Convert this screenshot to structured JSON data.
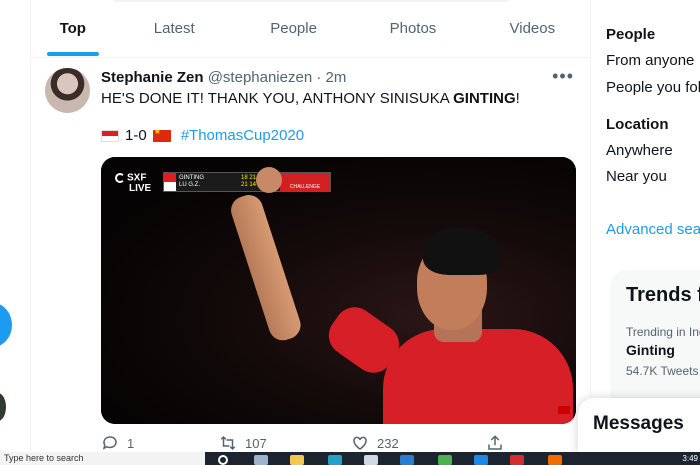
{
  "tabs": [
    {
      "label": "Top",
      "active": true
    },
    {
      "label": "Latest",
      "active": false
    },
    {
      "label": "People",
      "active": false
    },
    {
      "label": "Photos",
      "active": false
    },
    {
      "label": "Videos",
      "active": false
    }
  ],
  "tweet": {
    "author": "Stephanie Zen",
    "handle": "@stephaniezen",
    "separator": "·",
    "time": "2m",
    "more_icon": "more-horizontal-icon",
    "text_plain": "HE'S DONE IT! THANK YOU, ANTHONY SINISUKA ",
    "text_bold": "GINTING",
    "text_end": "!",
    "score": "1-0",
    "hashtag": "#ThomasCup2020",
    "flags": [
      "indonesia-flag",
      "china-flag"
    ],
    "media": {
      "logo_top": "SXF",
      "logo_bottom": "LIVE",
      "scoreboard": {
        "player1": "GINTING",
        "player2": "LU G.Z.",
        "scores1": "18 21 21",
        "scores2": "21 14 16",
        "label": "CHALLENGE"
      }
    },
    "actions": {
      "replies": "1",
      "retweets": "107",
      "likes": "232"
    }
  },
  "sidebar": {
    "people_heading": "People",
    "people_options": [
      "From anyone",
      "People you follow"
    ],
    "location_heading": "Location",
    "location_options": [
      "Anywhere",
      "Near you"
    ],
    "advanced": "Advanced search",
    "trends_title": "Trends for you",
    "trend_context": "Trending in Indonesia",
    "trend_name": "Ginting",
    "trend_count": "54.7K Tweets"
  },
  "messages_label": "Messages",
  "taskbar": {
    "search_placeholder": "Type here to search",
    "time": "3:49"
  },
  "colors": {
    "accent": "#1d9bf0",
    "text": "#0f1419",
    "muted": "#536471"
  }
}
